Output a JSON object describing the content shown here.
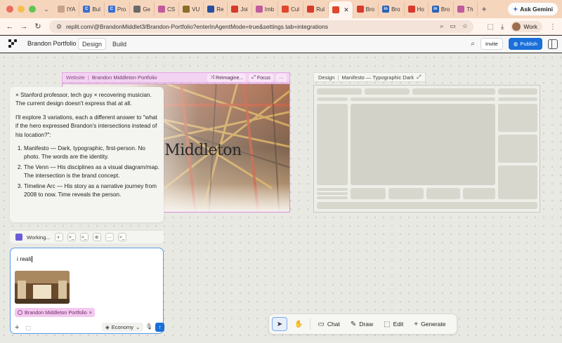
{
  "browser": {
    "tabs": [
      {
        "label": "IYA",
        "color": "#c8a38a",
        "glyph": ""
      },
      {
        "label": "Bul",
        "color": "#3b6fd1",
        "glyph": "C"
      },
      {
        "label": "Pro",
        "color": "#3b6fd1",
        "glyph": "C"
      },
      {
        "label": "Ge",
        "color": "#6a6a6a",
        "glyph": ""
      },
      {
        "label": "CS",
        "color": "#c25b9e",
        "glyph": ""
      },
      {
        "label": "VU",
        "color": "#8a6e2a",
        "glyph": ""
      },
      {
        "label": "Re",
        "color": "#2a4f9e",
        "glyph": ""
      },
      {
        "label": "Joi",
        "color": "#d63b2b",
        "glyph": ""
      },
      {
        "label": "Imb",
        "color": "#c25b9e",
        "glyph": ""
      },
      {
        "label": "Cul",
        "color": "#e0472c",
        "glyph": ""
      },
      {
        "label": "Rul",
        "color": "#d63b2b",
        "glyph": ""
      },
      {
        "label": "",
        "color": "#e0472c",
        "glyph": "",
        "active": true
      },
      {
        "label": "Bro",
        "color": "#d63b2b",
        "glyph": ""
      },
      {
        "label": "Bro",
        "color": "#2a64b8",
        "glyph": "in"
      },
      {
        "label": "Ho",
        "color": "#d63b2b",
        "glyph": ""
      },
      {
        "label": "Bro",
        "color": "#2a64b8",
        "glyph": "in"
      },
      {
        "label": "Th",
        "color": "#c25b9e",
        "glyph": ""
      }
    ],
    "url": "replit.com/@BrandonMiddlet3/Brandon-Portfolio?enterInAgentMode=true&settings.tab=integrations",
    "gemini_label": "Ask Gemini",
    "profile_label": "Work"
  },
  "app": {
    "project_name": "Brandon Portfolio",
    "mode_design": "Design",
    "mode_build": "Build",
    "invite_label": "Invite",
    "publish_label": "Publish"
  },
  "website_frame": {
    "label": "Website",
    "name": "Brandon Middleton Portfolio",
    "reimagine_label": "Reimagine...",
    "focus_label": "Focus",
    "hero_text": "n Middleton"
  },
  "design_frame": {
    "label": "Design",
    "name": "Manifesto — Typographic Dark"
  },
  "chat": {
    "intro": "× Stanford professor, tech guy × recovering musician. The current design doesn't express that at all.",
    "plan": "I'll explore 3 variations, each a different answer to \"what if the hero expressed Brandon's intersections instead of his location?\":",
    "items": [
      "Manifesto — Dark, typographic, first-person. No photo. The words are the identity.",
      "The Venn — His disciplines as a visual diagram/map. The intersection is the brand concept.",
      "Timeline Arc — His story as a narrative journey from 2008 to now. Time reveals the person."
    ],
    "working_label": "Working...",
    "input_value": "i reali",
    "context_chip": "Brandon Middleton Portfolio",
    "model_label": "Economy"
  },
  "toolbar": {
    "chat_label": "Chat",
    "draw_label": "Draw",
    "edit_label": "Edit",
    "generate_label": "Generate"
  },
  "colors": {
    "accent": "#1a6fd8",
    "frame_pink": "#d88fd8",
    "tab_strip": "#f6d5bd"
  }
}
